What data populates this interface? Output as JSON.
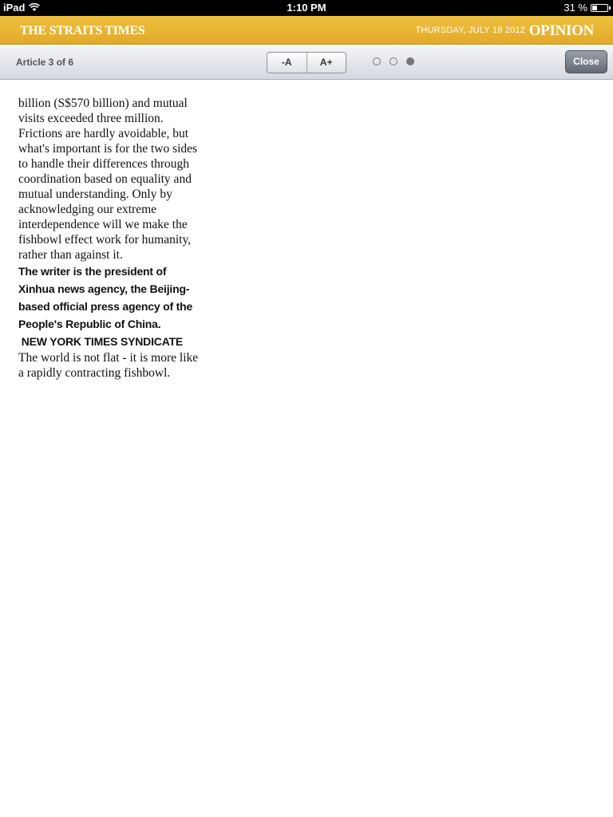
{
  "status_bar": {
    "device": "iPad",
    "time": "1:10 PM",
    "battery_text": "31 %",
    "battery_level": 0.31
  },
  "masthead": {
    "brand": "THE STRAITS TIMES",
    "date": "THURSDAY, JULY 19 2012",
    "section": "OPINION",
    "background_color": "#e6b130"
  },
  "toolbar": {
    "article_counter": "Article 3 of 6",
    "font_decrease": "-A",
    "font_increase": "A+",
    "pages_total": 3,
    "page_current": 3,
    "close_label": "Close"
  },
  "article": {
    "paragraphs": [
      "billion (S$570 billion) and mutual visits exceeded three million.",
      " Frictions are hardly avoidable, but what's important is for the two sides to handle their differences through coordination based on equality and mutual understanding. Only by acknowledging our extreme interdependence will we make the fishbowl effect work for humanity, rather than against it."
    ],
    "author_note": "The writer is the president of Xinhua news agency, the Beijing-based official press agency of the People's Republic of China.",
    "syndicate": " NEW YORK TIMES SYNDICATE",
    "closing": "The world is not flat - it is more like a rapidly contracting fishbowl."
  }
}
